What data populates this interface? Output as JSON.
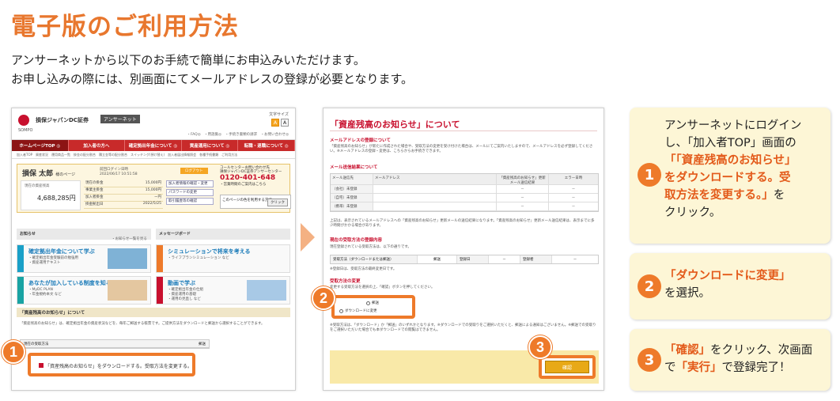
{
  "header": {
    "title": "電子版のご利用方法",
    "intro_line1": "アンサーネットから以下のお手続で簡単にお申込みいただけます。",
    "intro_line2": "お申し込みの際には、別画面にてメールアドレスの登録が必要となります。"
  },
  "screen1": {
    "brand": "損保ジャパンDC証券",
    "logo_sub": "SOMPO",
    "answer_net": "アンサーネット",
    "font_size_label": "文字サイズ",
    "font_small": "A",
    "font_large": "A",
    "top_links": "・FAQ◎　・用語集◎　・手続き書類の請求　・お問い合わせ◎",
    "nav": [
      "ホームページTOP ◎",
      "加入者の方へ",
      "確定拠出年金について ◎",
      "資産運用について ◎",
      "転職・退職について ◎"
    ],
    "subnav": "加入者TOP　資産状況　運用商品一覧　掛金の配分割合　積立金等の配分割合　スイッチング(預け替え)　加入者届出情報照会　各種手続書類　ご利用方法",
    "user_name": "損保 太郎",
    "user_suffix": "様のページ",
    "last_login_label": "前回ログイン日時",
    "last_login_value": "2022/06/17 10:51:58",
    "logout": "ログアウト",
    "asset_label": "現在の資産残高",
    "asset_value": "4,688,285円",
    "table": [
      {
        "label": "現在の掛金",
        "value": "15,000円"
      },
      {
        "label": "事業主掛金",
        "value": "15,000円"
      },
      {
        "label": "加入者掛金",
        "value": "ー円"
      },
      {
        "label": "掛金拠出日",
        "value": "2022/5/25"
      }
    ],
    "side_buttons": [
      "加入者情報の確認・変更",
      "パスワードの変更",
      "取引履歴等の確認"
    ],
    "call_center": "コールセンターお問い合わせ先",
    "call_sub": "損保ジャパンDC証券アンサーセンター",
    "phone": "0120-401-648",
    "hours": "・営業時間のご案内はこちら",
    "mobile_label": "このページの色を利用する方法",
    "mobile_btn": "クリック",
    "section_news": "お知らせ",
    "section_message": "メッセージボード",
    "more_news": "・お知らせ一覧を見る",
    "card1_title": "確定拠出年金について学ぶ",
    "card1_desc": "・確定拠出年金受験前の勉強用\n・資産運用テキスト",
    "card2_title": "シミュレーションで将来を考える",
    "card2_desc": "・ライフプランシミュレーション など",
    "card3_title": "あなたが加入している制度を知る",
    "card3_desc": "・MyDC PLAN\n・年金規約本文 など",
    "card4_title": "動画で学ぶ",
    "card4_desc": "・確定拠出年金の仕組\n・資産運用の基礎\n・運用の見直し など",
    "notice_head": "「資産残高のお知らせ」について",
    "notice_body": "「資産残高のお知らせ」は、確定拠出年金の資産状況などを、毎年ご郵送する帳票です。ご提供方法をダウンロードと郵送から選択することができます。",
    "method_label": "現在の受取方法",
    "method_value": "郵送",
    "highlight_text": "「資産残高のお知らせ」をダウンロードする。受取方法を変更する。"
  },
  "screen2": {
    "title": "「資産残高のお知らせ」について",
    "h_mail": "メールアドレスの登録について",
    "p_mail": "「資産残高のお知らせ」が新たに作成された場合や、受取方法の変更を受け付けた場合は、メールにてご案内いたしますので、メールアドレスを必ず登録してください。※メールアドレスの登録・変更は、こちらからお手続きできます。",
    "h_result": "メール送信結果について",
    "table_head": [
      "メール送信先",
      "メールアドレス",
      "「資産残高のお知らせ」更新メール送信結果",
      "エラー日時"
    ],
    "table_rows": [
      [
        "（会社）未登録",
        "",
        "－",
        "－"
      ],
      [
        "（自宅）未登録",
        "",
        "－",
        "－"
      ],
      [
        "（携帯）未登録",
        "",
        "－",
        "－"
      ]
    ],
    "p_result": "上記は、表示されているメールアドレスへの「資産残高のお知らせ」更新メールの送信結果になります。「資産残高のお知らせ」更新メール送信結果は、表示までに多少時間がかかる場合があります。",
    "h_current": "現在の受取方法の登録内容",
    "p_current": "現在登録されている受取方法は、以下の通りです。",
    "current_cells": [
      "受取方法（ダウンロードまたは郵送）",
      "郵送",
      "登録日",
      "－",
      "登録者",
      "－"
    ],
    "p_current_note": "※登録日は、受取方法の最終変更日です。",
    "h_change": "受取方法の変更",
    "p_change": "変更する受取方法を選択の上、「確認」ボタンを押してください。",
    "radio_mail": "郵送",
    "radio_download": "ダウンロードに変更",
    "p_notes": "※受取方法は、「ダウンロード」か「郵送」のいずれかとなります。※ダウンロードでの受取りをご選択いただくと、郵送による通知はございません。※郵送での受取りをご選択いただいた場合でも本ダウンロードでの閲覧はできません。",
    "confirm": "確認"
  },
  "badges": [
    "1",
    "2",
    "3"
  ],
  "steps": {
    "step1_num": "1",
    "step1_a": "アンサーネットにログイン",
    "step1_b": "し、「加入者TOP」画面の",
    "step1_hl1": "「「資産残高のお知らせ」",
    "step1_hl2": "をダウンロードする。受",
    "step1_hl3": "取方法を変更する。」",
    "step1_c": "を",
    "step1_d": "クリック。",
    "step2_num": "2",
    "step2_hl": "「ダウンロードに変更」",
    "step2_a": "を選択。",
    "step3_num": "3",
    "step3_hl1": "「確認」",
    "step3_a": "をクリック、次画面",
    "step3_b": "で",
    "step3_hl2": "「実行」",
    "step3_c": "で登録完了！"
  },
  "colors": {
    "accent": "#ee7a2a",
    "title": "#e8772e",
    "highlight_text": "#e35a1a",
    "step_bg": "#fdf6d6",
    "nav_red": "#c82a2a"
  }
}
